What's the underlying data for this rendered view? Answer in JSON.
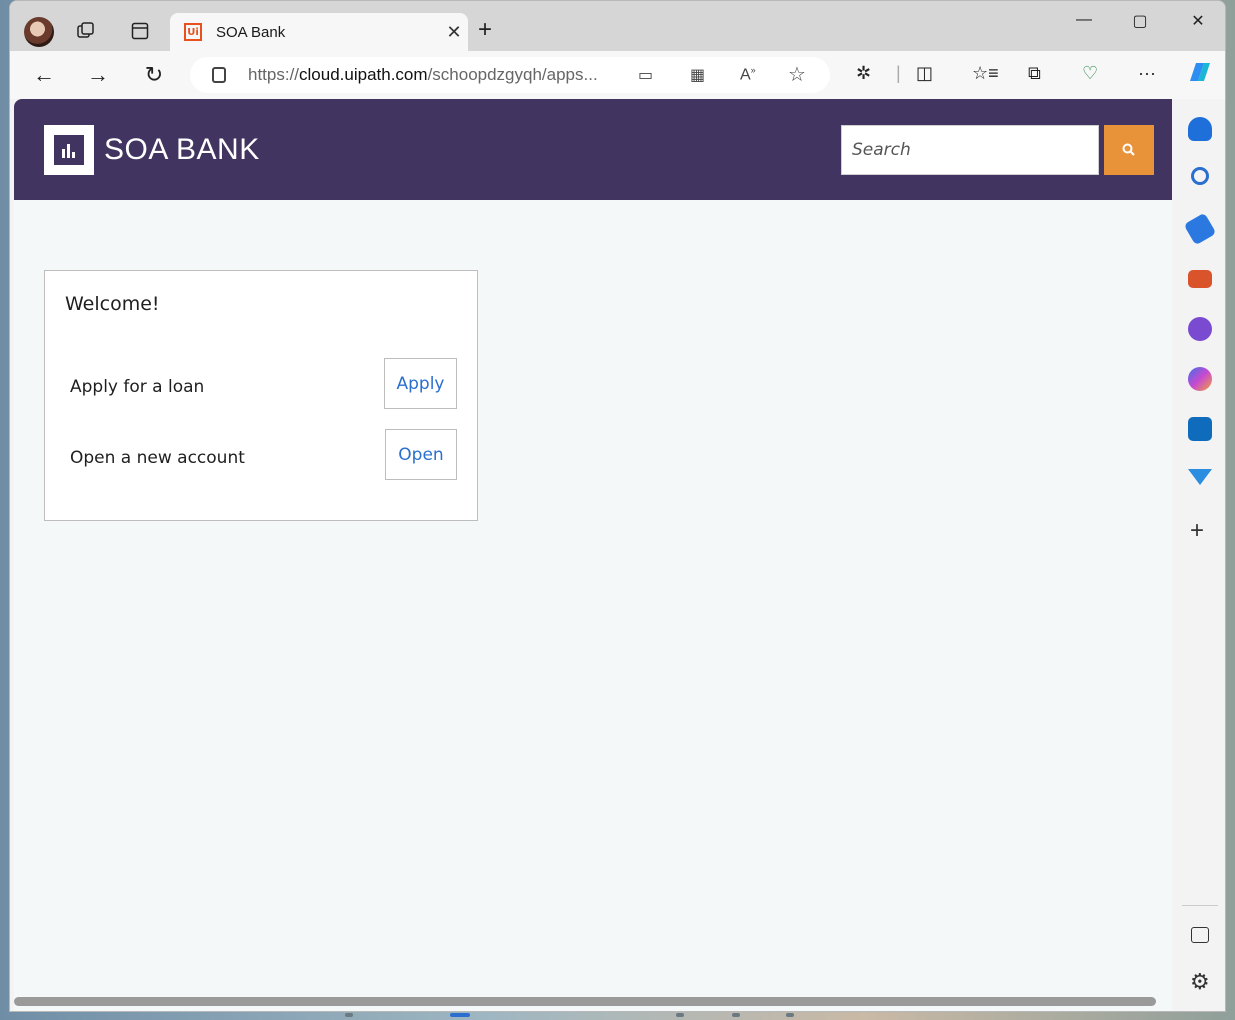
{
  "browser": {
    "tab_title": "SOA Bank",
    "tab_favicon": "Ui",
    "url_prefix": "https://",
    "url_host": "cloud.uipath.com",
    "url_path": "/schoopdzgyqh/apps...",
    "icons": [
      "profile-avatar",
      "workspaces-icon",
      "tab-actions-icon",
      "back-icon",
      "forward-icon",
      "refresh-icon",
      "lock-icon",
      "app-available-icon",
      "qr-icon",
      "read-aloud-icon",
      "favorite-star-icon",
      "extensions-icon",
      "split-screen-icon",
      "favorites-icon",
      "collections-icon",
      "browser-essentials-icon",
      "more-icon",
      "copilot-icon"
    ]
  },
  "sidebar": {
    "icons": [
      "bell-icon",
      "search-icon",
      "shopping-tag-icon",
      "tools-icon",
      "games-icon",
      "microsoft365-icon",
      "outlook-icon",
      "drop-icon",
      "add-icon",
      "sidebar-toggle-icon",
      "settings-icon"
    ]
  },
  "app": {
    "brand": "SOA BANK",
    "search_placeholder": "Search",
    "accent_color": "#423461",
    "search_button_color": "#e8933a",
    "card": {
      "title": "Welcome!",
      "rows": [
        {
          "label": "Apply for a loan",
          "button": "Apply"
        },
        {
          "label": "Open a new account",
          "button": "Open"
        }
      ]
    }
  }
}
